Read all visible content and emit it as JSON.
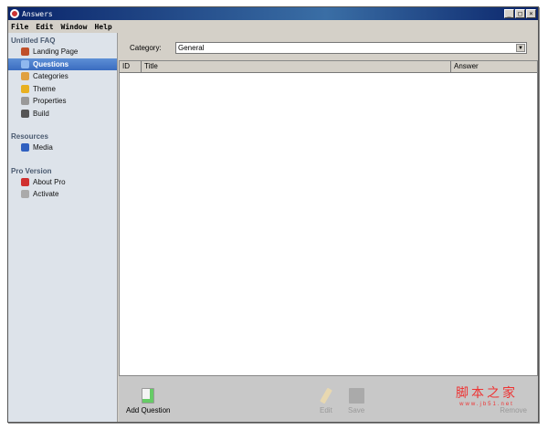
{
  "window": {
    "title": "Answers",
    "controls": [
      "_",
      "□",
      "×"
    ]
  },
  "menu": [
    "File",
    "Edit",
    "Window",
    "Help"
  ],
  "sidebar": {
    "sections": [
      {
        "title": "Untitled FAQ",
        "items": [
          {
            "label": "Landing Page",
            "icon": "home-icon",
            "color": "#c0502a"
          },
          {
            "label": "Questions",
            "icon": "questions-icon",
            "color": "#8fb8ee",
            "selected": true
          },
          {
            "label": "Categories",
            "icon": "categories-icon",
            "color": "#e0a040"
          },
          {
            "label": "Theme",
            "icon": "pencil-icon",
            "color": "#e8b020"
          },
          {
            "label": "Properties",
            "icon": "gear-icon",
            "color": "#999999"
          },
          {
            "label": "Build",
            "icon": "hammer-icon",
            "color": "#555555"
          }
        ]
      },
      {
        "title": "Resources",
        "items": [
          {
            "label": "Media",
            "icon": "media-icon",
            "color": "#3060c0"
          }
        ]
      },
      {
        "title": "Pro Version",
        "items": [
          {
            "label": "About Pro",
            "icon": "lifebuoy-icon",
            "color": "#d03030"
          },
          {
            "label": "Activate",
            "icon": "key-icon",
            "color": "#aaaaaa"
          }
        ]
      }
    ]
  },
  "main": {
    "category_label": "Category:",
    "category_value": "General",
    "columns": [
      "ID",
      "Title",
      "Answer"
    ]
  },
  "toolbar": {
    "add": "Add Question",
    "edit": "Edit",
    "save": "Save",
    "remove": "Remove"
  },
  "watermark": {
    "line1": "脚本之家",
    "line2": "www.jb51.net"
  }
}
